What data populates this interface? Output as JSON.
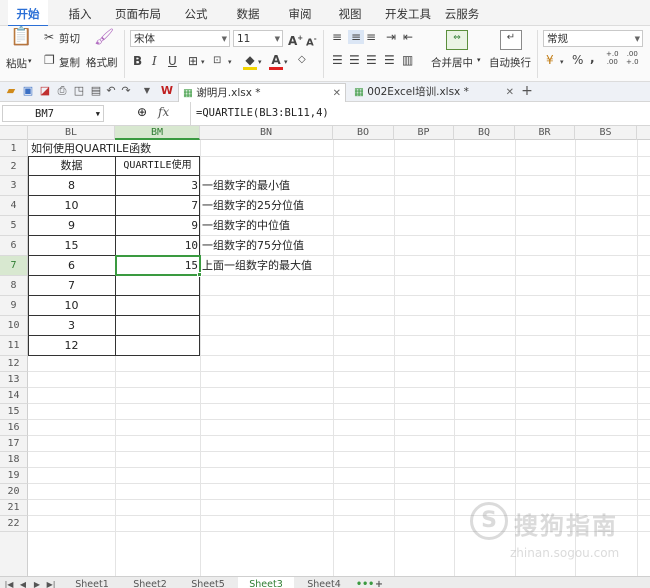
{
  "menu": {
    "tabs": [
      "开始",
      "插入",
      "页面布局",
      "公式",
      "数据",
      "审阅",
      "视图",
      "开发工具",
      "云服务"
    ],
    "active": 0
  },
  "ribbon": {
    "paste_label": "粘贴",
    "cut_label": "剪切",
    "copy_label": "复制",
    "format_painter_label": "格式刷",
    "font_name": "宋体",
    "font_size": "11",
    "bold": "B",
    "italic": "I",
    "underline": "U",
    "merge_center_label": "合并居中",
    "wrap_text_label": "自动换行",
    "number_format": "常规",
    "percent": "%",
    "comma": ",",
    "inc_decimal": "+.0\n.00",
    "dec_decimal": ".00\n+.0"
  },
  "doc_tabs": [
    {
      "label": "谢明月.xlsx *",
      "active": true
    },
    {
      "label": "002Excel培训.xlsx *",
      "active": false
    }
  ],
  "add_tab": "+",
  "formula_bar": {
    "name_box": "BM7",
    "fx": "fx",
    "formula": "=QUARTILE(BL3:BL11,4)"
  },
  "columns": [
    "BL",
    "BM",
    "BN",
    "BO",
    "BP",
    "BQ",
    "BR",
    "BS"
  ],
  "selected_column": "BM",
  "rows": [
    "1",
    "2",
    "3",
    "4",
    "5",
    "6",
    "7",
    "8",
    "9",
    "10",
    "11",
    "12",
    "13",
    "14",
    "15",
    "16",
    "17",
    "18",
    "19",
    "20",
    "21",
    "22"
  ],
  "selected_row": "7",
  "cells": {
    "title": "如何使用QUARTILE函数",
    "header_data": "数据",
    "header_quartile": "QUARTILE使用",
    "data": [
      "8",
      "10",
      "9",
      "15",
      "6",
      "7",
      "10",
      "3",
      "12"
    ],
    "results": [
      "3",
      "7",
      "9",
      "10",
      "15"
    ],
    "notes": [
      "一组数字的最小值",
      "一组数字的25分位值",
      "一组数字的中位值",
      "一组数字的75分位值",
      "上面一组数字的最大值"
    ]
  },
  "sheets": [
    "Sheet1",
    "Sheet2",
    "Sheet5",
    "Sheet3",
    "Sheet4"
  ],
  "active_sheet": "Sheet3",
  "watermark": {
    "text": "搜狗指南",
    "url": "zhinan.sogou.com"
  },
  "colors": {
    "accent": "#2b6fd6",
    "selection": "#3a9a40"
  }
}
